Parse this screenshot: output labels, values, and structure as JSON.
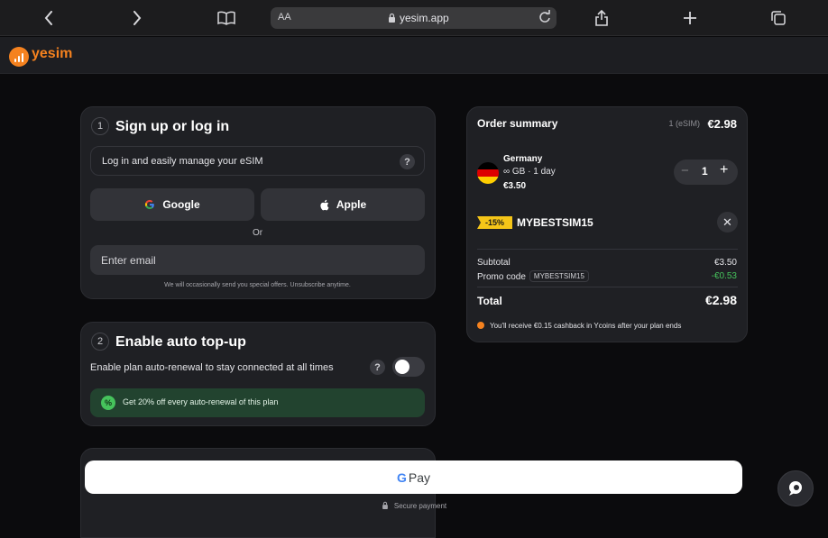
{
  "browser": {
    "aa_label": "AA",
    "url": "yesim.app",
    "back_icon": "chevron-left-icon",
    "forward_icon": "chevron-right-icon",
    "bookmarks_icon": "book-icon",
    "reload_icon": "reload-icon",
    "share_icon": "share-icon",
    "new_tab_icon": "plus-icon",
    "tabs_icon": "tabs-icon"
  },
  "header": {
    "logo_text": "yesim",
    "brand_color": "#f5821f"
  },
  "step1": {
    "number": "1",
    "title": "Sign up or log in",
    "info_text": "Log in and easily manage your eSIM",
    "help": "?",
    "google_label": "Google",
    "apple_label": "Apple",
    "or_label": "Or",
    "email_placeholder": "Enter email",
    "fine_print": "We will occasionally send you special offers. Unsubscribe anytime."
  },
  "step2": {
    "number": "2",
    "title": "Enable auto top-up",
    "auto_text": "Enable plan auto-renewal to stay connected at all times",
    "help": "?",
    "toggle_on": false,
    "promo_icon": "%",
    "promo_text": "Get 20% off every auto-renewal of this plan"
  },
  "order": {
    "title": "Order summary",
    "count": "1 (eSIM)",
    "total_top": "€2.98",
    "item": {
      "country": "Germany",
      "plan": "∞ GB · 1 day",
      "price": "€3.50",
      "minus": "−",
      "qty": "1",
      "plus": "+"
    },
    "discount_tag": "-15%",
    "promo_code": "MYBESTSIM15",
    "remove": "✕",
    "subtotal_label": "Subtotal",
    "subtotal_value": "€3.50",
    "promo_label": "Promo code",
    "promo_chip": "MYBESTSIM15",
    "promo_value": "-€0.53",
    "total_label": "Total",
    "total_value": "€2.98",
    "cashback": "You'll receive €0.15 cashback in Ycoins after your plan ends"
  },
  "payment": {
    "gpay_g": "G",
    "gpay_pay": "Pay",
    "secure_text": "Secure payment"
  },
  "colors": {
    "accent": "#f5821f",
    "success": "#46c35c",
    "discount": "#f5c518",
    "card_bg": "#1f2024"
  }
}
